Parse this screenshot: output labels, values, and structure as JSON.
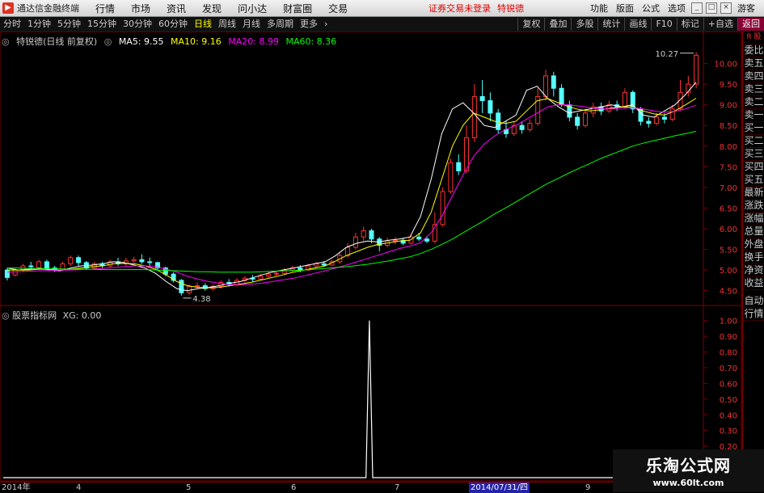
{
  "menubar": {
    "app_title": "通达信金融终端",
    "items": [
      "行情",
      "市场",
      "资讯",
      "发现",
      "问小达",
      "财富圈",
      "交易"
    ],
    "notice": "证券交易未登录",
    "stock_name": "特锐德",
    "right_items": [
      "功能",
      "版面",
      "公式",
      "选项"
    ],
    "guest": "游客"
  },
  "toolbar": {
    "periods": [
      "分时",
      "1分钟",
      "5分钟",
      "15分钟",
      "30分钟",
      "60分钟",
      "日线",
      "周线",
      "月线",
      "多周期",
      "更多"
    ],
    "active": "日线",
    "right_buttons": [
      "复权",
      "叠加",
      "多股",
      "统计",
      "画线",
      "F10",
      "标记",
      "+自选",
      "返回"
    ]
  },
  "legend": {
    "title": "特锐德(日线 前复权)",
    "ma5": "MA5: 9.55",
    "ma10": "MA10: 9.16",
    "ma20": "MA20: 8.99",
    "ma60": "MA60: 8.36"
  },
  "indicator_legend": {
    "name": "股票指标网",
    "value": "XG: 0.00"
  },
  "colors": {
    "up": "#ff3232",
    "down": "#54ffff",
    "ma5": "#ffffff",
    "ma10": "#ffff00",
    "ma20": "#ff00ff",
    "ma60": "#00ff00",
    "grid": "#800000"
  },
  "chart_data": [
    {
      "type": "candlestick",
      "title": "特锐德(日线 前复权)",
      "y_ticks": [
        10.0,
        9.5,
        9.0,
        8.5,
        8.0,
        7.5,
        7.0,
        6.5,
        6.0,
        5.5,
        5.0,
        4.5
      ],
      "ylim": [
        4.2,
        10.5
      ],
      "annotations": [
        {
          "label": "10.27"
        },
        {
          "label": "4.38"
        }
      ],
      "series": [
        {
          "name": "MA5",
          "values": [
            5.05,
            5.0,
            5.02,
            5.05,
            5.0,
            4.98,
            5.05,
            5.1,
            5.12,
            5.15,
            5.2,
            5.18,
            5.12,
            5.05,
            4.92,
            4.72,
            4.55,
            4.5,
            4.55,
            4.58,
            4.62,
            4.68,
            4.72,
            4.8,
            4.88,
            4.95,
            5.0,
            5.05,
            5.1,
            5.15,
            5.2,
            5.35,
            5.55,
            5.65,
            5.7,
            5.68,
            5.72,
            5.75,
            5.8,
            6.3,
            7.2,
            8.3,
            8.9,
            9.05,
            8.8,
            8.5,
            8.45,
            8.6,
            8.75,
            9.35,
            9.45,
            9.15,
            8.95,
            8.8,
            8.85,
            8.9,
            8.95,
            9.0,
            8.95,
            9.0,
            8.75,
            8.7,
            8.85,
            9.0,
            9.25,
            9.55
          ]
        },
        {
          "name": "MA10",
          "values": [
            5.0,
            5.0,
            5.0,
            5.02,
            5.02,
            5.0,
            5.02,
            5.05,
            5.08,
            5.1,
            5.15,
            5.16,
            5.15,
            5.1,
            5.02,
            4.88,
            4.72,
            4.62,
            4.58,
            4.57,
            4.58,
            4.62,
            4.66,
            4.7,
            4.76,
            4.82,
            4.88,
            4.95,
            5.0,
            5.05,
            5.1,
            5.22,
            5.35,
            5.45,
            5.55,
            5.62,
            5.66,
            5.7,
            5.72,
            5.9,
            6.4,
            7.2,
            8.0,
            8.5,
            8.8,
            8.7,
            8.6,
            8.55,
            8.6,
            8.85,
            9.1,
            9.15,
            9.05,
            8.95,
            8.88,
            8.85,
            8.88,
            8.92,
            8.95,
            8.95,
            8.85,
            8.78,
            8.75,
            8.85,
            9.0,
            9.16
          ]
        },
        {
          "name": "MA20",
          "values": [
            4.95,
            4.96,
            4.97,
            4.98,
            4.99,
            5.0,
            5.0,
            5.01,
            5.02,
            5.04,
            5.06,
            5.08,
            5.1,
            5.1,
            5.08,
            5.02,
            4.95,
            4.85,
            4.78,
            4.72,
            4.68,
            4.65,
            4.64,
            4.66,
            4.68,
            4.72,
            4.76,
            4.8,
            4.86,
            4.92,
            4.98,
            5.05,
            5.12,
            5.2,
            5.28,
            5.36,
            5.44,
            5.52,
            5.58,
            5.66,
            5.9,
            6.3,
            6.8,
            7.3,
            7.75,
            8.05,
            8.25,
            8.4,
            8.5,
            8.65,
            8.8,
            8.95,
            9.0,
            9.0,
            8.97,
            8.93,
            8.9,
            8.9,
            8.92,
            8.93,
            8.9,
            8.85,
            8.82,
            8.84,
            8.9,
            8.99
          ]
        },
        {
          "name": "MA60",
          "values": [
            5.05,
            5.05,
            5.04,
            5.04,
            5.03,
            5.03,
            5.02,
            5.02,
            5.02,
            5.01,
            5.01,
            5.01,
            5.01,
            5.01,
            5.0,
            4.99,
            4.98,
            4.97,
            4.96,
            4.96,
            4.95,
            4.95,
            4.95,
            4.95,
            4.96,
            4.97,
            4.98,
            4.99,
            5.0,
            5.02,
            5.04,
            5.06,
            5.08,
            5.11,
            5.14,
            5.18,
            5.22,
            5.27,
            5.32,
            5.4,
            5.5,
            5.62,
            5.75,
            5.9,
            6.05,
            6.2,
            6.36,
            6.5,
            6.65,
            6.8,
            6.95,
            7.1,
            7.22,
            7.35,
            7.47,
            7.58,
            7.7,
            7.8,
            7.9,
            8.0,
            8.07,
            8.13,
            8.19,
            8.25,
            8.3,
            8.36
          ]
        }
      ]
    },
    {
      "type": "line",
      "title": "股票指标网",
      "y_ticks": [
        1.0,
        0.9,
        0.8,
        0.7,
        0.6,
        0.5,
        0.4,
        0.3,
        0.2
      ],
      "ylim": [
        0,
        1.05
      ],
      "series": [
        {
          "name": "XG",
          "values": [
            0,
            0,
            0,
            0,
            0,
            0,
            0,
            0,
            0,
            0,
            0,
            0,
            0,
            0,
            0,
            0,
            0,
            0,
            0,
            0,
            0,
            0,
            0,
            0,
            0,
            0,
            0,
            0,
            0,
            0,
            0,
            0,
            0,
            0,
            0,
            0,
            0,
            0,
            0,
            0,
            0,
            0,
            0,
            0,
            0,
            0,
            0,
            0,
            0,
            0,
            0,
            0,
            0,
            0,
            0,
            0,
            0,
            0,
            0,
            0,
            0,
            0,
            0,
            0,
            0,
            0,
            0,
            0,
            0,
            0,
            0,
            0,
            0,
            0,
            0,
            0,
            0,
            0,
            0,
            0,
            0,
            0,
            0,
            0,
            0,
            0,
            0,
            0,
            0,
            0,
            0,
            0,
            0,
            0,
            0,
            0,
            0,
            0,
            0,
            0,
            0,
            0,
            0,
            0,
            0,
            0,
            0,
            0,
            0,
            1,
            0,
            0,
            0,
            0,
            0,
            0,
            0,
            0,
            0,
            0,
            0,
            0,
            0,
            0,
            0,
            0,
            0,
            0,
            0,
            0,
            0,
            0,
            0,
            0,
            0,
            0,
            0,
            0,
            0,
            0,
            0,
            0,
            0,
            0,
            0,
            0,
            0,
            0,
            0,
            0,
            0,
            0,
            0,
            0,
            0,
            0,
            0,
            0,
            0,
            0,
            0,
            0,
            0,
            0,
            0,
            0,
            0,
            0,
            0,
            0,
            0,
            0,
            0,
            0,
            0,
            0,
            0,
            0,
            0,
            0,
            0,
            0,
            0,
            0,
            0,
            0,
            0,
            0,
            0,
            0,
            0,
            0,
            0,
            0,
            0,
            0,
            0,
            0,
            0,
            0,
            0,
            0,
            0,
            0,
            0,
            0,
            0,
            0
          ]
        }
      ]
    }
  ],
  "candles": [
    [
      5.0,
      4.82,
      5.05,
      4.75
    ],
    [
      4.88,
      5.0,
      5.05,
      4.85
    ],
    [
      5.0,
      5.1,
      5.15,
      4.95
    ],
    [
      5.1,
      5.08,
      5.2,
      5.0
    ],
    [
      5.05,
      5.2,
      5.25,
      5.0
    ],
    [
      5.2,
      5.05,
      5.25,
      5.0
    ],
    [
      5.05,
      5.0,
      5.1,
      4.95
    ],
    [
      5.0,
      5.15,
      5.2,
      4.98
    ],
    [
      5.15,
      5.3,
      5.35,
      5.1
    ],
    [
      5.3,
      5.18,
      5.35,
      5.1
    ],
    [
      5.18,
      5.05,
      5.22,
      5.0
    ],
    [
      5.05,
      5.15,
      5.2,
      5.0
    ],
    [
      5.15,
      5.1,
      5.2,
      5.05
    ],
    [
      5.1,
      5.2,
      5.25,
      5.05
    ],
    [
      5.2,
      5.15,
      5.3,
      5.1
    ],
    [
      5.15,
      5.22,
      5.3,
      5.1
    ],
    [
      5.22,
      5.25,
      5.32,
      5.18
    ],
    [
      5.25,
      5.2,
      5.38,
      5.15
    ],
    [
      5.2,
      5.18,
      5.3,
      5.1
    ],
    [
      5.18,
      5.05,
      5.2,
      5.0
    ],
    [
      5.05,
      4.9,
      5.08,
      4.85
    ],
    [
      4.9,
      4.75,
      4.95,
      4.7
    ],
    [
      4.75,
      4.45,
      4.78,
      4.38
    ],
    [
      4.45,
      4.6,
      4.65,
      4.4
    ],
    [
      4.6,
      4.62,
      4.7,
      4.55
    ],
    [
      4.62,
      4.55,
      4.68,
      4.5
    ],
    [
      4.55,
      4.6,
      4.65,
      4.5
    ],
    [
      4.6,
      4.7,
      4.75,
      4.55
    ],
    [
      4.7,
      4.65,
      4.78,
      4.6
    ],
    [
      4.65,
      4.75,
      4.8,
      4.6
    ],
    [
      4.75,
      4.8,
      4.85,
      4.7
    ],
    [
      4.8,
      4.78,
      4.88,
      4.72
    ],
    [
      4.78,
      4.85,
      4.9,
      4.75
    ],
    [
      4.85,
      4.9,
      4.95,
      4.8
    ],
    [
      4.9,
      4.92,
      4.98,
      4.85
    ],
    [
      4.92,
      5.0,
      5.05,
      4.88
    ],
    [
      5.0,
      5.05,
      5.1,
      4.95
    ],
    [
      5.05,
      5.0,
      5.12,
      4.95
    ],
    [
      5.0,
      5.1,
      5.15,
      4.98
    ],
    [
      5.1,
      5.15,
      5.2,
      5.05
    ],
    [
      5.15,
      5.12,
      5.22,
      5.08
    ],
    [
      5.12,
      5.2,
      5.25,
      5.1
    ],
    [
      5.2,
      5.35,
      5.42,
      5.15
    ],
    [
      5.35,
      5.55,
      5.65,
      5.3
    ],
    [
      5.55,
      5.8,
      5.9,
      5.5
    ],
    [
      5.8,
      5.95,
      6.05,
      5.7
    ],
    [
      5.95,
      5.75,
      6.0,
      5.65
    ],
    [
      5.75,
      5.6,
      5.8,
      5.45
    ],
    [
      5.6,
      5.7,
      5.78,
      5.55
    ],
    [
      5.7,
      5.72,
      5.8,
      5.62
    ],
    [
      5.72,
      5.65,
      5.78,
      5.6
    ],
    [
      5.65,
      5.8,
      5.85,
      5.62
    ],
    [
      5.8,
      5.75,
      5.9,
      5.7
    ],
    [
      5.75,
      5.7,
      5.82,
      5.65
    ],
    [
      5.7,
      6.1,
      6.4,
      5.65
    ],
    [
      6.1,
      6.9,
      7.0,
      6.05
    ],
    [
      6.9,
      7.6,
      7.7,
      6.85
    ],
    [
      7.6,
      7.4,
      7.8,
      7.3
    ],
    [
      7.4,
      8.2,
      8.5,
      7.35
    ],
    [
      8.2,
      9.2,
      9.5,
      8.1
    ],
    [
      9.2,
      9.1,
      9.6,
      8.8
    ],
    [
      9.1,
      8.8,
      9.3,
      8.6
    ],
    [
      8.8,
      8.4,
      8.9,
      8.3
    ],
    [
      8.4,
      8.3,
      8.6,
      8.2
    ],
    [
      8.3,
      8.5,
      8.6,
      8.25
    ],
    [
      8.5,
      8.4,
      8.6,
      8.3
    ],
    [
      8.4,
      8.55,
      8.65,
      8.35
    ],
    [
      8.55,
      9.2,
      9.4,
      8.5
    ],
    [
      9.2,
      9.7,
      9.85,
      9.1
    ],
    [
      9.7,
      9.4,
      9.8,
      9.2
    ],
    [
      9.4,
      9.0,
      9.5,
      8.95
    ],
    [
      9.0,
      8.7,
      9.1,
      8.6
    ],
    [
      8.7,
      8.5,
      8.8,
      8.4
    ],
    [
      8.5,
      8.8,
      8.9,
      8.45
    ],
    [
      8.8,
      8.95,
      9.05,
      8.7
    ],
    [
      8.95,
      8.85,
      9.05,
      8.75
    ],
    [
      8.85,
      9.0,
      9.1,
      8.8
    ],
    [
      9.0,
      8.95,
      9.1,
      8.85
    ],
    [
      8.95,
      9.3,
      9.4,
      8.9
    ],
    [
      9.3,
      8.9,
      9.35,
      8.8
    ],
    [
      8.9,
      8.6,
      8.95,
      8.5
    ],
    [
      8.6,
      8.55,
      8.7,
      8.45
    ],
    [
      8.55,
      8.7,
      8.8,
      8.5
    ],
    [
      8.7,
      8.65,
      8.8,
      8.55
    ],
    [
      8.65,
      8.9,
      9.0,
      8.6
    ],
    [
      8.9,
      9.3,
      9.6,
      8.85
    ],
    [
      9.3,
      9.5,
      9.7,
      9.2
    ],
    [
      9.5,
      10.2,
      10.27,
      9.4
    ]
  ],
  "side_panel": {
    "top_label": "R 股",
    "items": [
      "委比",
      "卖五",
      "卖四",
      "卖三",
      "卖二",
      "卖一",
      "买一",
      "买二",
      "买三",
      "买四",
      "买五",
      "最新",
      "涨跌",
      "涨幅",
      "总量",
      "外盘",
      "换手",
      "净资",
      "收益"
    ],
    "lower_items": [
      "自动",
      "行情"
    ]
  },
  "date_axis": {
    "labels": [
      "2014年",
      "4",
      "5",
      "6",
      "7",
      "2014/07/31/四",
      "9"
    ]
  },
  "watermark": {
    "line1": "乐淘公式网",
    "line2": "www.60lt.com"
  }
}
